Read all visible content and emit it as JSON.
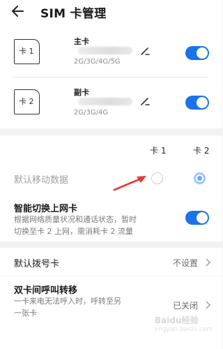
{
  "header": {
    "title": "SIM 卡管理"
  },
  "sims": [
    {
      "icon_label": "卡 1",
      "name": "主卡",
      "network": "2G/3G/4G/5G",
      "enabled": true
    },
    {
      "icon_label": "卡 2",
      "name": "副卡",
      "network": "2G/3G/4G",
      "enabled": true
    }
  ],
  "data_section": {
    "col_sim1": "卡 1",
    "col_sim2": "卡 2",
    "default_data_label": "默认移动数据",
    "selected_default_data": "卡 2",
    "smart_switch_title": "智能切换上网卡",
    "smart_switch_desc_line1": "根据网络质量状况和通话状态，暂时",
    "smart_switch_desc_line2": "切换至卡 2 上网，需消耗卡 2 流量",
    "smart_switch_enabled": true
  },
  "dial": {
    "label": "默认拨号卡",
    "value": "不设置"
  },
  "forward": {
    "title": "双卡间呼叫转移",
    "desc_line1": "一卡来电无法呼入时，呼转至另",
    "desc_line2": "一张卡",
    "value": "已关闭"
  },
  "colors": {
    "accent": "#1a73e8",
    "arrow": "#e53935"
  },
  "icons": [
    "back-arrow-icon",
    "sim-card-icon",
    "edit-pencil-icon",
    "chevron-right-icon",
    "annotation-arrow"
  ]
}
